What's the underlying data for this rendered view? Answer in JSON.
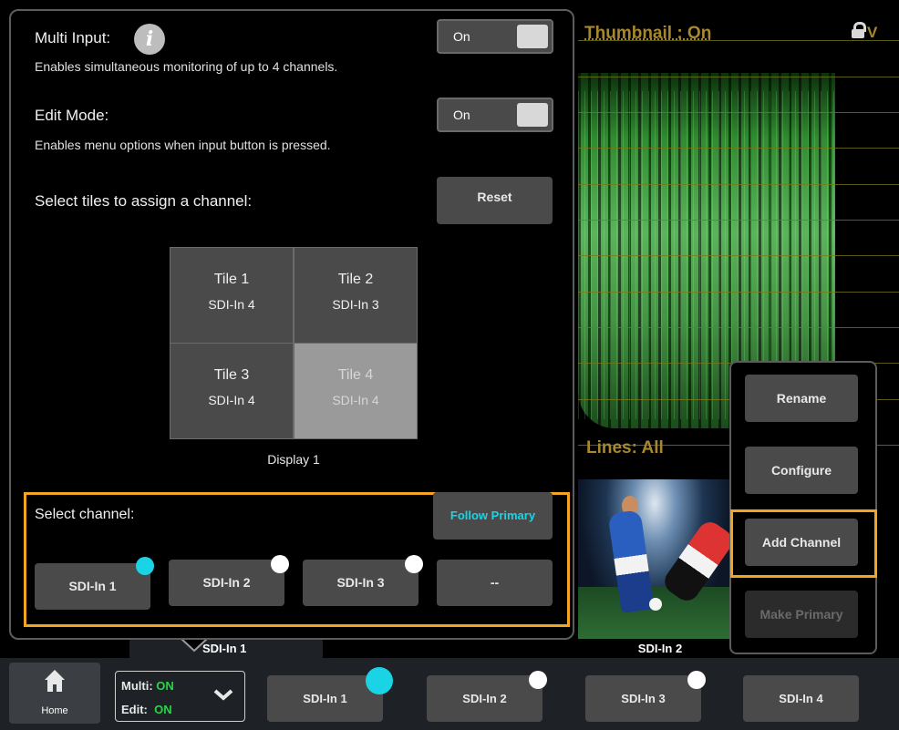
{
  "background": {
    "thumbnail_title": "Thumbnail : On",
    "v_label": "V",
    "lines_label": "Lines: All",
    "tile_sdi1_label": "SDI-In 1",
    "tile_sdi2_label": "SDI-In 2"
  },
  "panel": {
    "multi_input": {
      "label": "Multi Input:",
      "info_icon": "i",
      "description": "Enables simultaneous monitoring of up to 4 channels.",
      "toggle_value": "On"
    },
    "edit_mode": {
      "label": "Edit Mode:",
      "description": "Enables menu options when input button is pressed.",
      "toggle_value": "On"
    },
    "assign": {
      "label": "Select tiles to assign a channel:",
      "reset_label": "Reset"
    },
    "tiles": [
      {
        "name": "Tile 1",
        "channel": "SDI-In 4",
        "selected": false
      },
      {
        "name": "Tile 2",
        "channel": "SDI-In 3",
        "selected": false
      },
      {
        "name": "Tile 3",
        "channel": "SDI-In 4",
        "selected": false
      },
      {
        "name": "Tile 4",
        "channel": "SDI-In 4",
        "selected": true
      }
    ],
    "display_label": "Display 1",
    "select_channel": {
      "label": "Select channel:",
      "follow_primary_label": "Follow Primary",
      "channels": [
        "SDI-In 1",
        "SDI-In 2",
        "SDI-In 3",
        "--"
      ]
    }
  },
  "context_menu": {
    "items": [
      "Rename",
      "Configure",
      "Add Channel",
      "Make Primary"
    ],
    "disabled": [
      "Make Primary"
    ],
    "highlighted": "Add Channel"
  },
  "bottom_bar": {
    "home_label": "Home",
    "status": {
      "multi_label": "Multi:",
      "multi_value": "ON",
      "edit_label": "Edit:",
      "edit_value": "ON"
    },
    "inputs": [
      "SDI-In 1",
      "SDI-In 2",
      "SDI-In 3",
      "SDI-In 4"
    ]
  },
  "colors": {
    "highlight": "#f3a521",
    "primary_dot": "#1ad4e6",
    "status_on": "#2ad34b",
    "trace_label": "#a8882c"
  }
}
